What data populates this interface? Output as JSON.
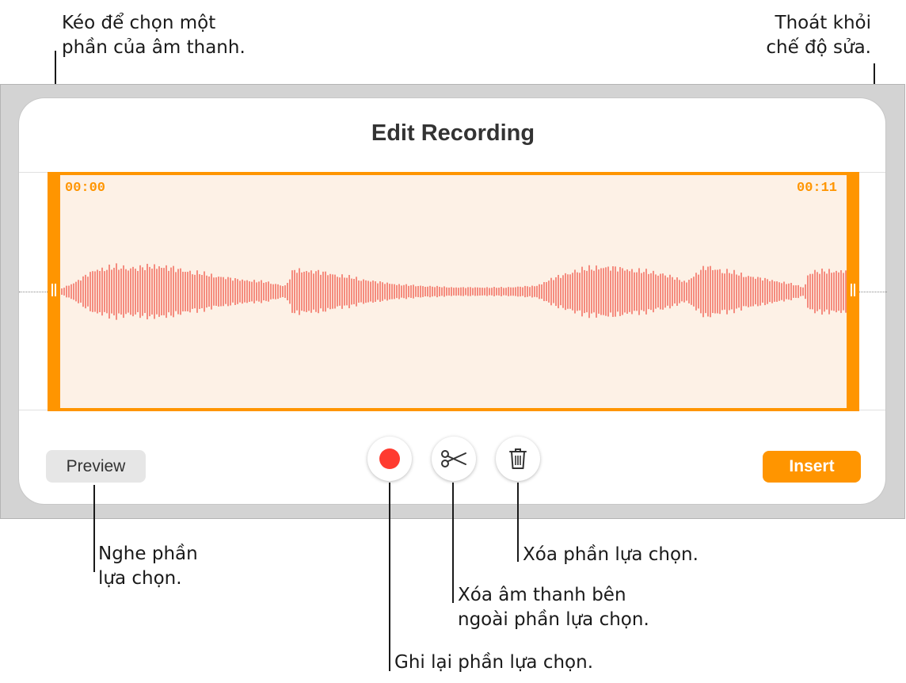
{
  "callouts": {
    "select_line1": "Kéo để chọn một",
    "select_line2": "phần của âm thanh.",
    "exit_line1": "Thoát khỏi",
    "exit_line2": "chế độ sửa.",
    "preview_line1": "Nghe phần",
    "preview_line2": "lựa chọn.",
    "delete_text": "Xóa phần lựa chọn.",
    "trim_line1": "Xóa âm thanh bên",
    "trim_line2": "ngoài phần lựa chọn.",
    "record_text": "Ghi lại phần lựa chọn."
  },
  "dialog": {
    "title": "Edit Recording",
    "start_time": "00:00",
    "end_time": "00:11",
    "preview_label": "Preview",
    "insert_label": "Insert"
  },
  "icons": {
    "record": "record-dot-icon",
    "trim": "scissors-icon",
    "delete": "trash-icon"
  },
  "colors": {
    "accent": "#ff9500",
    "waveform": "#f04a3a",
    "record": "#ff3b30",
    "selection_bg": "#fdf1e6"
  }
}
